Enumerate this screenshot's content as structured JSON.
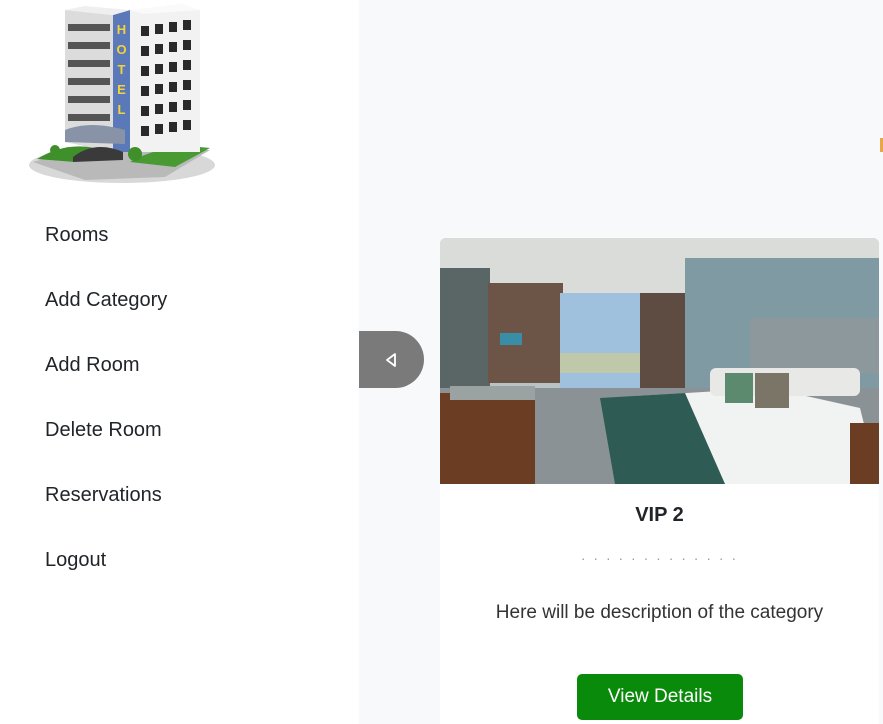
{
  "sidebar": {
    "logo_icon": "hotel-building-icon",
    "logo_text": "HOTEL",
    "items": [
      {
        "label": "Rooms"
      },
      {
        "label": "Add Category"
      },
      {
        "label": "Add Room"
      },
      {
        "label": "Delete Room"
      },
      {
        "label": "Reservations"
      },
      {
        "label": "Logout"
      }
    ]
  },
  "toggle": {
    "icon": "caret-left-icon"
  },
  "card": {
    "image": "hotel-bedroom-photo",
    "title": "VIP 2",
    "divider": "· · · · · · · · · · · · ·",
    "description": "Here will be description of the category",
    "button_label": "View Details"
  },
  "colors": {
    "sidebar_bg": "#ffffff",
    "main_bg": "#f8f9fa",
    "toggle_bg": "#7a7a7a",
    "button_bg": "#0a8a0a",
    "text": "#212529"
  }
}
